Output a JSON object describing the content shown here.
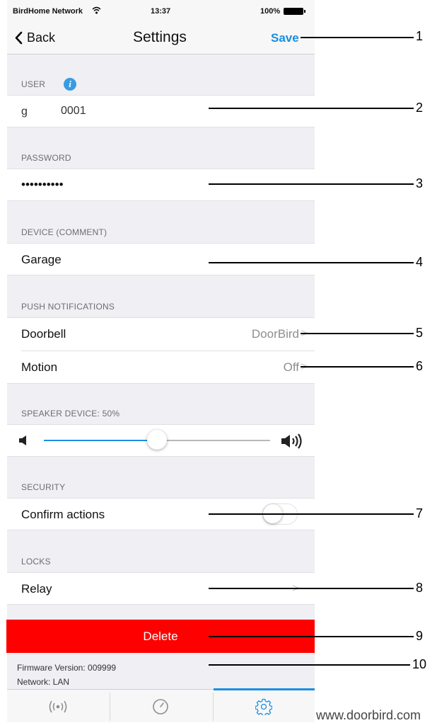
{
  "status": {
    "carrier": "BirdHome Network",
    "time": "13:37",
    "battery": "100%",
    "wifi_icon": "wifi-icon",
    "battery_icon": "battery-icon"
  },
  "nav": {
    "back": "Back",
    "title": "Settings",
    "save": "Save"
  },
  "sections": {
    "user": {
      "header": "USER",
      "value_prefix": "g",
      "value": "0001"
    },
    "password": {
      "header": "PASSWORD",
      "value": "••••••••••"
    },
    "device": {
      "header": "DEVICE (COMMENT)",
      "value": "Garage"
    },
    "push": {
      "header": "PUSH NOTIFICATIONS",
      "doorbell": {
        "label": "Doorbell",
        "value": "DoorBird"
      },
      "motion": {
        "label": "Motion",
        "value": "Off"
      }
    },
    "speaker": {
      "header": "SPEAKER DEVICE: 50%",
      "level": 0.5
    },
    "security": {
      "header": "SECURITY",
      "confirm_label": "Confirm actions",
      "confirm_on": false
    },
    "locks": {
      "header": "LOCKS",
      "relay_label": "Relay"
    }
  },
  "delete_label": "Delete",
  "firmware": "Firmware Version: 009999",
  "network": "Network: LAN",
  "watermark": "www.doorbird.com",
  "callouts": [
    "1",
    "2",
    "3",
    "4",
    "5",
    "6",
    "7",
    "8",
    "9",
    "10"
  ],
  "colors": {
    "accent": "#1a8ee1",
    "delete": "#ff0000",
    "info": "#3a9ce0"
  }
}
